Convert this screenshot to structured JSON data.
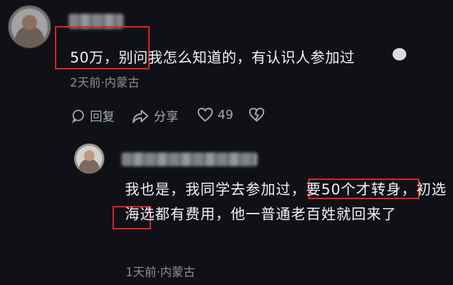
{
  "comment": {
    "username": "",
    "text": "50万，别问我怎么知道的，有认识人参加过",
    "meta": "2天前·内蒙古",
    "actions": {
      "reply": "回复",
      "share": "分享",
      "like_count": "49"
    }
  },
  "reply": {
    "username": "",
    "text": "我也是，我同学去参加过，要50个才转身，初选海选都有费用，他一普通老百姓就回来了",
    "meta": "1天前·内蒙古"
  },
  "colors": {
    "background": "#0f1116",
    "highlight": "#e0262a",
    "muted_text": "#8b8f96"
  }
}
